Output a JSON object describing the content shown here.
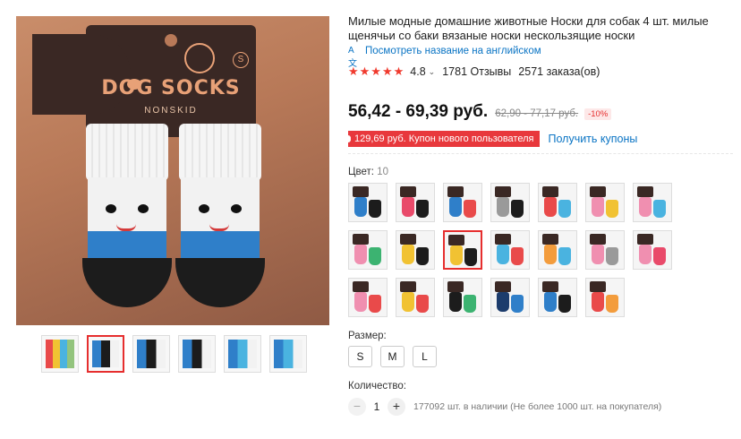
{
  "main_image": {
    "brand": "DOG SOCKS",
    "sub": "NONSKID",
    "size_mark": "S"
  },
  "thumbnails": [
    {
      "colors": [
        "#e94a4a",
        "#f1c232",
        "#4ab3e0",
        "#93c47d"
      ],
      "active": false
    },
    {
      "colors": [
        "#2f7fc9",
        "#1c1c1c",
        "#f2f2f2"
      ],
      "active": true
    },
    {
      "colors": [
        "#2f7fc9",
        "#1c1c1c",
        "#f2f2f2"
      ],
      "active": false
    },
    {
      "colors": [
        "#2f7fc9",
        "#1c1c1c",
        "#f2f2f2"
      ],
      "active": false
    },
    {
      "colors": [
        "#2f7fc9",
        "#4ab3e0",
        "#f2f2f2"
      ],
      "active": false
    },
    {
      "colors": [
        "#2f7fc9",
        "#4ab3e0",
        "#f2f2f2"
      ],
      "active": false
    }
  ],
  "product": {
    "title": "Милые модные домашние животные Носки для собак 4 шт. милые щенячьи со баки вязаные носки нескользящие носки",
    "translate_link": "Посмотреть название на английском",
    "stars": "★★★★★",
    "rating": "4.8",
    "reviews": "1781 Отзывы",
    "orders": "2571 заказа(ов)",
    "price": "56,42 - 69,39 руб.",
    "old_price": "62,90 - 77,17 руб.",
    "discount": "-10%",
    "coupon": "129,69 руб. Купон нового пользователя",
    "get_coupons": "Получить купоны"
  },
  "color": {
    "label": "Цвет:",
    "count": "10",
    "swatches": [
      {
        "a": "#2f7fc9",
        "b": "#1c1c1c",
        "active": false
      },
      {
        "a": "#e94a6a",
        "b": "#1c1c1c",
        "active": false
      },
      {
        "a": "#2f7fc9",
        "b": "#e94a4a",
        "active": false
      },
      {
        "a": "#9a9a9a",
        "b": "#1c1c1c",
        "active": false
      },
      {
        "a": "#e94a4a",
        "b": "#4ab3e0",
        "active": false
      },
      {
        "a": "#f08fb0",
        "b": "#f1c232",
        "active": false
      },
      {
        "a": "#f08fb0",
        "b": "#4ab3e0",
        "active": false
      },
      {
        "a": "#f08fb0",
        "b": "#3cb371",
        "active": false
      },
      {
        "a": "#f1c232",
        "b": "#1c1c1c",
        "active": false
      },
      {
        "a": "#f1c232",
        "b": "#1c1c1c",
        "active": true
      },
      {
        "a": "#4ab3e0",
        "b": "#e94a4a",
        "active": false
      },
      {
        "a": "#f39c3c",
        "b": "#4ab3e0",
        "active": false
      },
      {
        "a": "#f08fb0",
        "b": "#9a9a9a",
        "active": false
      },
      {
        "a": "#f08fb0",
        "b": "#e94a6a",
        "active": false
      },
      {
        "a": "#f08fb0",
        "b": "#e94a4a",
        "active": false
      },
      {
        "a": "#f1c232",
        "b": "#e94a4a",
        "active": false
      },
      {
        "a": "#1c1c1c",
        "b": "#3cb371",
        "active": false
      },
      {
        "a": "#1c3c6c",
        "b": "#2f7fc9",
        "active": false
      },
      {
        "a": "#2f7fc9",
        "b": "#1c1c1c",
        "active": false
      },
      {
        "a": "#e94a4a",
        "b": "#f39c3c",
        "active": false
      }
    ]
  },
  "size": {
    "label": "Размер:",
    "options": [
      "S",
      "M",
      "L"
    ]
  },
  "quantity": {
    "label": "Количество:",
    "value": "1",
    "minus": "−",
    "plus": "+",
    "stock": "177092 шт. в наличии (Не более 1000 шт. на покупателя)"
  }
}
